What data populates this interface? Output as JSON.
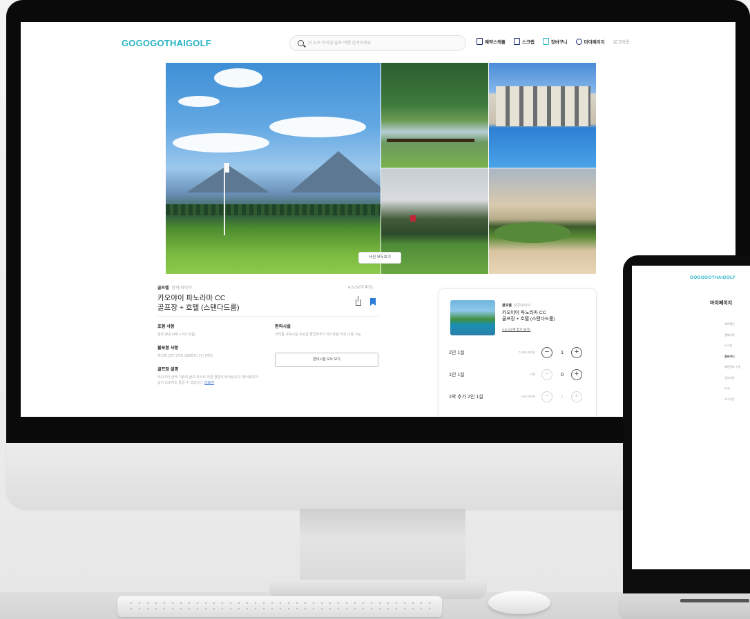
{
  "site": {
    "logo": "GOGOGOTHAIGOLF",
    "search_placeholder": "이 도로 라이딩 골프 여행 검색하세요",
    "nav": [
      {
        "label": "예약스케쥴",
        "icon": "calendar-icon"
      },
      {
        "label": "스크랩",
        "icon": "bookmark-icon"
      },
      {
        "label": "장바구니",
        "icon": "cart-icon"
      },
      {
        "label": "마이페이지",
        "icon": "user-icon"
      },
      {
        "label": "로그아웃",
        "icon": ""
      }
    ]
  },
  "gallery": {
    "view_all_photos_label": "사진 모두보기"
  },
  "product": {
    "category": "골프텔",
    "category_sub": "방콕/파타야",
    "rating_text": "4.5 (32개 후기)",
    "title_line1": "카오야이 파노라마 CC",
    "title_line2": "골프장 + 호텔 (스탠다드룸)",
    "sections": [
      {
        "title": "포함 사항",
        "text": "왕복 항공 (4박 + 5다 포함)"
      },
      {
        "title": "불포함 사항",
        "text": "캐디피 (2인 1카트 300바트) 1인 1캐디"
      },
      {
        "title": "골프장 설명",
        "text": "카오야이 산맥 기슭의 골프 코스로 자연 경관이 뛰어납니다. 페어웨이가 넓어 초보자도 즐길 수 있습니다.",
        "more": "더보기"
      }
    ],
    "facilities": {
      "title": "편의시설",
      "text": "라커룸 샤워시설 프로샵 클럽하우스 레스토랑 카트 이용 가능"
    },
    "view_all_facilities_label": "편의시설 모두 보기"
  },
  "booking": {
    "category": "골프텔",
    "category_sub": "방콕/파타야",
    "name_line1": "카오야이 파노라마 CC",
    "name_line2": "골프장 + 호텔 (스탠다드룸)",
    "rating_text": "4.5 (32개 후기 보기)",
    "options": [
      {
        "label": "2인 1실",
        "price": "7,400,000원",
        "qty": "1",
        "minus_active": true,
        "plus_active": true
      },
      {
        "label": "1인 1실",
        "price": "0원",
        "qty": "0",
        "minus_active": false,
        "plus_active": true
      },
      {
        "label": "1박 추가 2인 1실",
        "price": "150,000원",
        "qty": "1",
        "minus_active": false,
        "plus_active": false
      }
    ]
  },
  "laptop": {
    "logo": "GOGOGOTHAIGOLF",
    "title": "마이페이지",
    "menu": [
      "예약확인",
      "결제내역",
      "스크랩",
      "장바구니",
      "회원정보 수정",
      "공지사항",
      "FAQ",
      "로그아웃"
    ],
    "active_index": 3
  },
  "colors": {
    "brand": "#2ab5c5",
    "accent_blue": "#2b7bd6",
    "nav_icon": "#1a2a6c"
  }
}
